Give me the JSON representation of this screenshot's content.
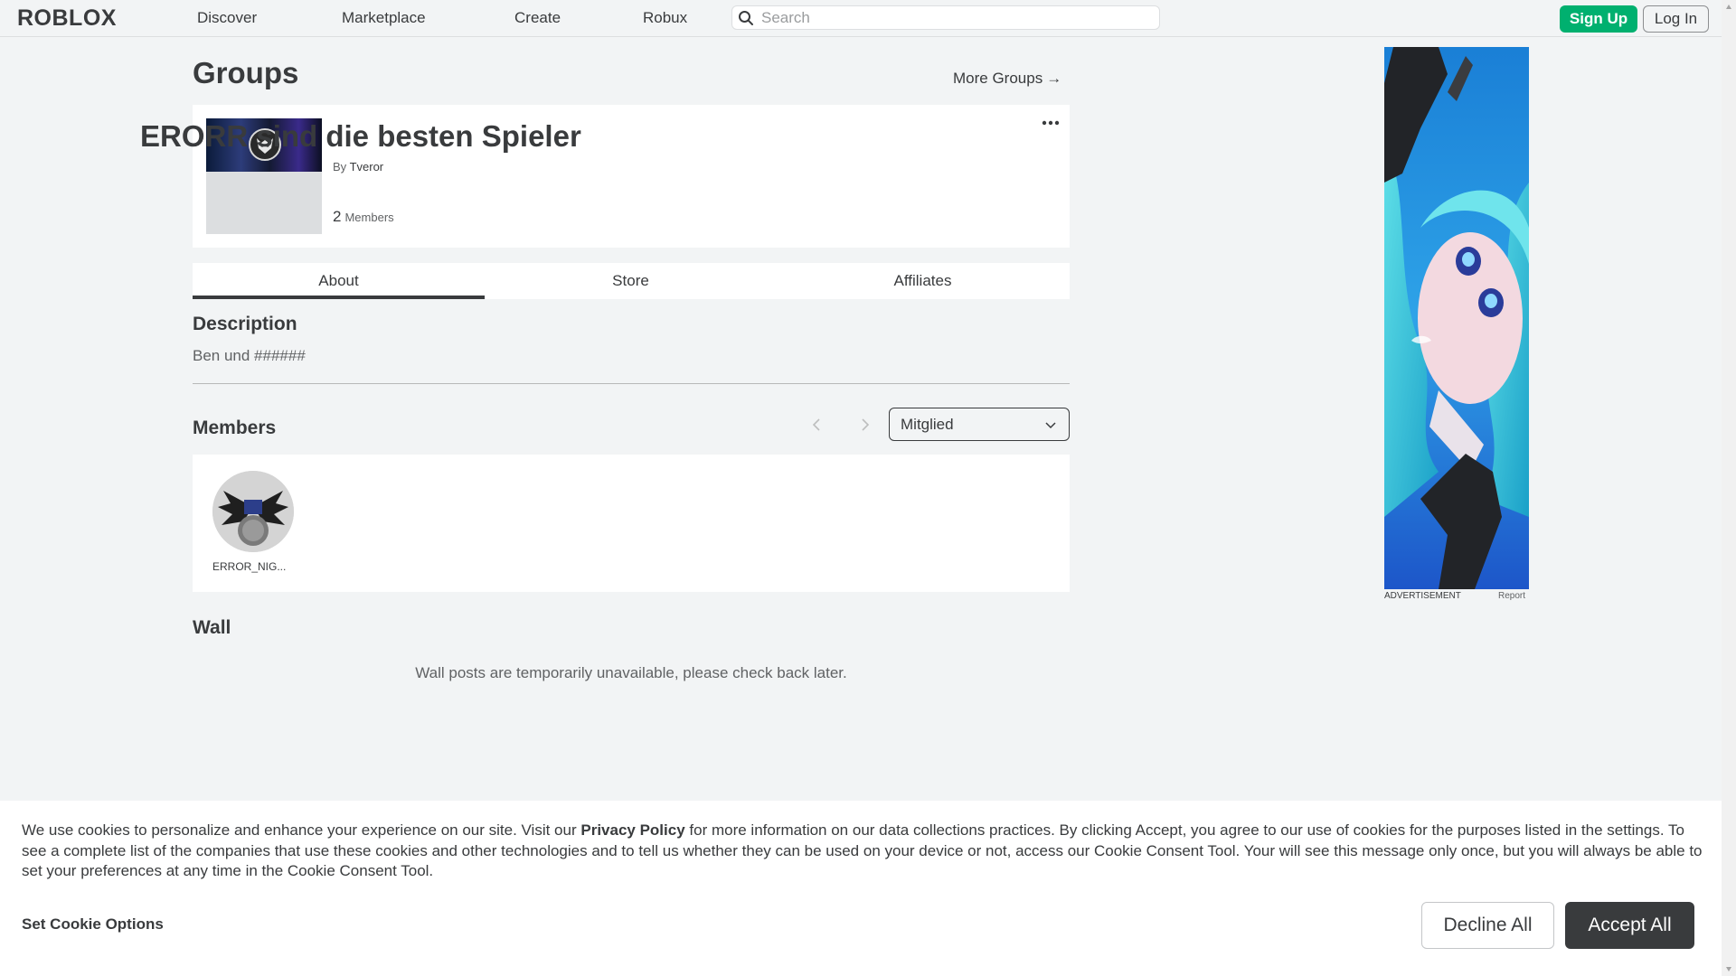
{
  "header": {
    "logo": "ROBLOX",
    "nav": [
      "Discover",
      "Marketplace",
      "Create",
      "Robux"
    ],
    "search_placeholder": "Search",
    "signup_label": "Sign Up",
    "login_label": "Log In"
  },
  "page": {
    "title": "Groups",
    "more_groups": "More Groups",
    "more_groups_icon": "arrow-right-icon"
  },
  "group": {
    "name": "ERORR sind die besten Spieler",
    "by_label": "By",
    "owner": "Tveror",
    "member_count": "2",
    "member_label": "Members",
    "menu_icon": "more-dots-icon"
  },
  "tabs": [
    {
      "label": "About",
      "active": true
    },
    {
      "label": "Store",
      "active": false
    },
    {
      "label": "Affiliates",
      "active": false
    }
  ],
  "about": {
    "description_heading": "Description",
    "description_text": "Ben und ######",
    "members_heading": "Members",
    "role_selected": "Mitglied",
    "members": [
      {
        "name": "ERROR_NIG..."
      }
    ],
    "wall_heading": "Wall",
    "wall_message": "Wall posts are temporarily unavailable, please check back later."
  },
  "ad": {
    "label": "ADVERTISEMENT",
    "report": "Report"
  },
  "cookie": {
    "text_before": "We use cookies to personalize and enhance your experience on our site. Visit our ",
    "privacy_link": "Privacy Policy",
    "text_after": " for more information on our data collections practices. By clicking Accept, you agree to our use of cookies for the purposes listed in the settings. To see a complete list of the companies that use these cookies and other technologies and to tell us whether they can be used on your device or not, access our Cookie Consent Tool. Your will see this message only once, but you will always be able to set your preferences at any time in the Cookie Consent Tool.",
    "options_label": "Set Cookie Options",
    "decline_label": "Decline All",
    "accept_label": "Accept All"
  },
  "colors": {
    "page_bg": "#f2f4f5",
    "text": "#393b3d",
    "signup_green": "#00b06f",
    "accept_dark": "#393b3d"
  }
}
